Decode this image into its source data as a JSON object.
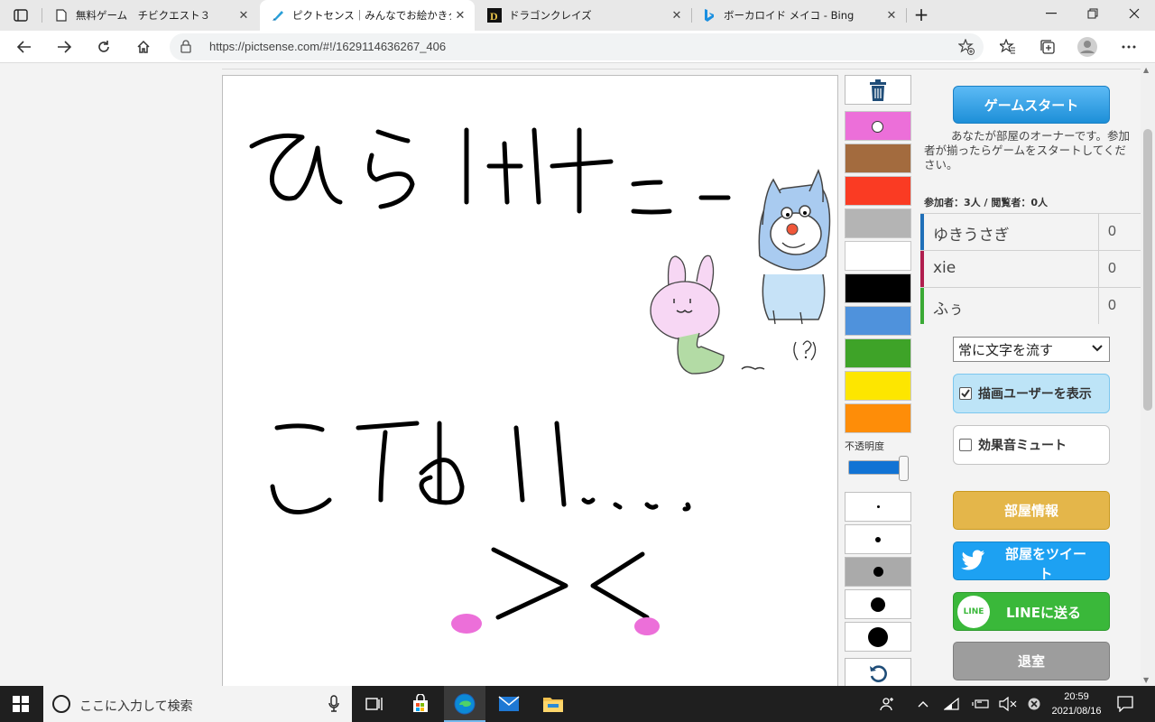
{
  "browser": {
    "tabs": [
      {
        "title": "無料ゲーム　チビクエスト３",
        "close": "✕"
      },
      {
        "title": "ピクトセンス｜みんなでお絵かきクイズ",
        "close": "✕"
      },
      {
        "title": "ドラゴンクレイズ",
        "close": "✕"
      },
      {
        "title": "ボーカロイド メイコ - Bing",
        "close": "✕"
      }
    ],
    "new_tab": "+",
    "url": "https://pictsense.com/#!/1629114636267_406"
  },
  "palette": {
    "colors": [
      "#ec6fd9",
      "#a36b3e",
      "#fa3b23",
      "#b4b4b4",
      "#ffffff",
      "#000000",
      "#4f92dc",
      "#3ea328",
      "#fde600",
      "#fe8d08"
    ],
    "selected_index": 0,
    "opacity_label": "不透明度",
    "opacity_value": 0.95,
    "brush_sizes": [
      3,
      6,
      11,
      16,
      22
    ],
    "selected_brush_index": 2
  },
  "panel": {
    "start_button": "ゲームスタート",
    "owner_message": "あなたが部屋のオーナーです。参加者が揃ったらゲームをスタートしてください。",
    "counts": "参加者：3人 / 閲覧者：0人",
    "players": [
      {
        "name": "ゆきうさぎ",
        "score": "0",
        "color": "#1f6fb8"
      },
      {
        "name": "xie",
        "score": "0",
        "color": "#b01e4e"
      },
      {
        "name": "ふぅ",
        "score": "0",
        "color": "#3aaa35"
      }
    ],
    "mode_select": "常に文字を流す",
    "show_drawer": {
      "label": "描画ユーザーを表示",
      "checked": true
    },
    "mute_sound": {
      "label": "効果音ミュート",
      "checked": false
    },
    "room_info": "部屋情報",
    "tweet": "部屋をツイート",
    "line": "LINEに送る",
    "line_logo": "LINE",
    "leave": "退室"
  },
  "taskbar": {
    "search_placeholder": "ここに入力して検索",
    "time": "20:59",
    "date": "2021/08/16"
  }
}
